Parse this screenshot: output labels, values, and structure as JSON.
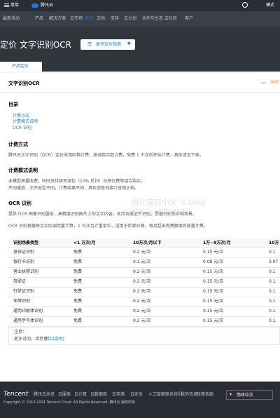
{
  "topbar": {
    "menu": "菜单",
    "brand": "腾讯云",
    "mode": "模式"
  },
  "nav": [
    "最新活动",
    "产品",
    "解决方案",
    "云市场",
    "定价",
    "文档",
    "支持",
    "云计划",
    "合作与生态",
    "云社区",
    "客户"
  ],
  "hero": {
    "title": "定价   文字识别OCR",
    "select_label": "更多定价指南"
  },
  "tab": {
    "label": "产品定价"
  },
  "panel": {
    "title": "文字识别OCR",
    "action": "关闭"
  },
  "doc": {
    "toc_title": "目录",
    "toc_items": [
      "计费方式",
      "计费模式说明",
      "OCR 识别"
    ],
    "billing_title": "计费方式",
    "billing_text": "腾讯云文字识别（OCR）定价采用阶梯计费，按调用次数计费，免费 1 千次后开始计费，具体请见下表。",
    "rules_title": "计费模式说明",
    "rules_text_1": "本模型按量收费，同时支持按资源包（10% 折扣）与预付费等组合购买。",
    "rules_text_2": "不同通道、文件类型不同，计费结果不同，具体请查询接口说明文档。",
    "ocr_title": "OCR 识别",
    "ocr_text_1": "提供 OCR 图像识别服务，高精度识别图片上的文字内容，支持各类证件识别、票据识别等多种场景。",
    "ocr_text_2": "OCR 识别根据每月实际调用量计算，1 万次为计量单位，适用于阶梯价格，每月超出免费额度后按量计费。",
    "notes_title": "注意：",
    "notes_text": "更多说明，请参考",
    "notes_link": "[接口说明]"
  },
  "table": {
    "headers": [
      "识别场景类型",
      "<1 万次/月",
      "10万次/月以下",
      "1万~9万次/月",
      "10万"
    ],
    "rows": [
      [
        "身份证识别",
        "免费",
        "0.2 元/次",
        "0.15 元/次",
        "0.1"
      ],
      [
        "银行卡识别",
        "免费",
        "0.1 元/次",
        "0.08 元/次",
        "0.07"
      ],
      [
        "营业执照识别",
        "免费",
        "0.2 元/次",
        "0.15 元/次",
        "0.1"
      ],
      [
        "驾驶证",
        "免费",
        "0.2 元/次",
        "0.15 元/次",
        "0.1"
      ],
      [
        "行驶证识别",
        "免费",
        "0.2 元/次",
        "0.15 元/次",
        "0.1"
      ],
      [
        "车牌识别",
        "免费",
        "0.2 元/次",
        "0.15 元/次",
        "0.1"
      ],
      [
        "通用印刷体识别",
        "免费",
        "0.2 元/次",
        "0.15 元/次",
        "0.1"
      ],
      [
        "通用手写体识别",
        "免费",
        "0.2 元/次",
        "0.15 元/次",
        "0.1"
      ]
    ]
  },
  "watermark": {
    "line1": "图片来自小文’ s blog",
    "line2": "版权与转载说明"
  },
  "footer": {
    "brand": "Tencent",
    "links": [
      "腾讯云总览",
      "云服务",
      "云计算",
      "云数据库",
      "云存储",
      "云安全",
      "人工智能",
      "联系我们",
      "我的信息",
      "政策条款"
    ],
    "copyright": "Copyright © 2013-2024 Tencent Cloud. All Rights Reserved. 腾讯云 版权所有",
    "lang": "简体中文"
  }
}
